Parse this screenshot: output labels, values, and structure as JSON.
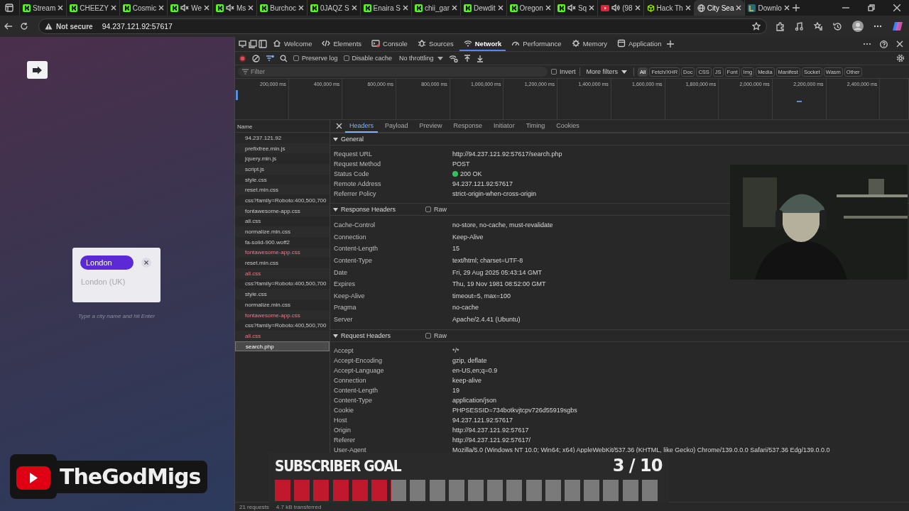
{
  "browser": {
    "tabs": [
      {
        "title": "Stream",
        "kind": "kick",
        "muted": false,
        "audible": false,
        "selected": false
      },
      {
        "title": "CHEEZY",
        "kind": "kick",
        "muted": false,
        "audible": false,
        "selected": false
      },
      {
        "title": "Cosmic",
        "kind": "kick",
        "muted": false,
        "audible": false,
        "selected": false
      },
      {
        "title": "We",
        "kind": "kick",
        "muted": true,
        "audible": false,
        "selected": false
      },
      {
        "title": "Ms",
        "kind": "kick",
        "muted": true,
        "audible": false,
        "selected": false
      },
      {
        "title": "Burchoc",
        "kind": "kick",
        "muted": false,
        "audible": false,
        "selected": false
      },
      {
        "title": "0JAQZ S",
        "kind": "kick",
        "muted": false,
        "audible": false,
        "selected": false
      },
      {
        "title": "Enaira S",
        "kind": "kick",
        "muted": false,
        "audible": false,
        "selected": false
      },
      {
        "title": "chii_gar",
        "kind": "kick",
        "muted": false,
        "audible": false,
        "selected": false
      },
      {
        "title": "Dewdit",
        "kind": "kick",
        "muted": false,
        "audible": false,
        "selected": false
      },
      {
        "title": "Oregon",
        "kind": "kick",
        "muted": false,
        "audible": false,
        "selected": false
      },
      {
        "title": "Sq",
        "kind": "kick",
        "muted": true,
        "audible": false,
        "selected": false
      },
      {
        "title": "(98",
        "kind": "video",
        "muted": false,
        "audible": true,
        "selected": false
      },
      {
        "title": "Hack Th",
        "kind": "cube",
        "muted": false,
        "audible": false,
        "selected": false
      },
      {
        "title": "City Sea",
        "kind": "globe",
        "muted": false,
        "audible": false,
        "selected": true
      },
      {
        "title": "Downlo",
        "kind": "download",
        "muted": false,
        "audible": false,
        "selected": false
      }
    ],
    "address": {
      "security": "Not secure",
      "url": "94.237.121.92:57617"
    }
  },
  "page": {
    "tags": [
      {
        "label": "London"
      }
    ],
    "suggestion": "London (UK)",
    "hint": "Type a city name and hit Enter"
  },
  "devtools": {
    "tabs": [
      {
        "label": "Welcome",
        "kind": "home",
        "selected": false
      },
      {
        "label": "Elements",
        "kind": "code",
        "selected": false
      },
      {
        "label": "Console",
        "kind": "console",
        "selected": false
      },
      {
        "label": "Sources",
        "kind": "bug",
        "selected": false
      },
      {
        "label": "Network",
        "kind": "wifi",
        "selected": true
      },
      {
        "label": "Performance",
        "kind": "gauge",
        "selected": false
      },
      {
        "label": "Memory",
        "kind": "chip",
        "selected": false
      },
      {
        "label": "Application",
        "kind": "window",
        "selected": false
      }
    ],
    "toolbar": {
      "preserve_log": {
        "label": "Preserve log",
        "checked": false
      },
      "disable_cache": {
        "label": "Disable cache",
        "checked": false
      },
      "throttling": "No throttling"
    },
    "filter": {
      "placeholder": "Filter",
      "invert": {
        "label": "Invert",
        "checked": false
      },
      "more_filters": "More filters",
      "types": [
        {
          "label": "All",
          "selected": true
        },
        {
          "label": "Fetch/XHR",
          "selected": false
        },
        {
          "label": "Doc",
          "selected": false
        },
        {
          "label": "CSS",
          "selected": false
        },
        {
          "label": "JS",
          "selected": false
        },
        {
          "label": "Font",
          "selected": false
        },
        {
          "label": "Img",
          "selected": false
        },
        {
          "label": "Media",
          "selected": false
        },
        {
          "label": "Manifest",
          "selected": false
        },
        {
          "label": "Socket",
          "selected": false
        },
        {
          "label": "Wasm",
          "selected": false
        },
        {
          "label": "Other",
          "selected": false
        }
      ]
    },
    "timeline": {
      "ticks": [
        "200,000 ms",
        "400,000 ms",
        "600,000 ms",
        "800,000 ms",
        "1,000,000 ms",
        "1,200,000 ms",
        "1,400,000 ms",
        "1,600,000 ms",
        "1,800,000 ms",
        "2,000,000 ms",
        "2,200,000 ms",
        "2,400,000 ms"
      ]
    },
    "requests": {
      "column": "Name",
      "items": [
        {
          "name": "94.237.121.92",
          "failed": false,
          "selected": false
        },
        {
          "name": "prefixfree.min.js",
          "failed": false,
          "selected": false
        },
        {
          "name": "jquery.min.js",
          "failed": false,
          "selected": false
        },
        {
          "name": "script.js",
          "failed": false,
          "selected": false
        },
        {
          "name": "style.css",
          "failed": false,
          "selected": false
        },
        {
          "name": "reset.min.css",
          "failed": false,
          "selected": false
        },
        {
          "name": "css?family=Roboto:400,500,700",
          "failed": false,
          "selected": false
        },
        {
          "name": "fontawesome-app.css",
          "failed": false,
          "selected": false
        },
        {
          "name": "all.css",
          "failed": false,
          "selected": false
        },
        {
          "name": "normalize.min.css",
          "failed": false,
          "selected": false
        },
        {
          "name": "fa-solid-900.woff2",
          "failed": false,
          "selected": false
        },
        {
          "name": "fontawesome-app.css",
          "failed": true,
          "selected": false
        },
        {
          "name": "reset.min.css",
          "failed": false,
          "selected": false
        },
        {
          "name": "all.css",
          "failed": true,
          "selected": false
        },
        {
          "name": "css?family=Roboto:400,500,700",
          "failed": false,
          "selected": false
        },
        {
          "name": "style.css",
          "failed": false,
          "selected": false
        },
        {
          "name": "normalize.min.css",
          "failed": false,
          "selected": false
        },
        {
          "name": "fontawesome-app.css",
          "failed": true,
          "selected": false
        },
        {
          "name": "css?family=Roboto:400,500,700",
          "failed": false,
          "selected": false
        },
        {
          "name": "all.css",
          "failed": true,
          "selected": false
        },
        {
          "name": "search.php",
          "failed": false,
          "selected": true
        }
      ]
    },
    "details": {
      "tabs": [
        {
          "label": "Headers",
          "selected": true
        },
        {
          "label": "Payload",
          "selected": false
        },
        {
          "label": "Preview",
          "selected": false
        },
        {
          "label": "Response",
          "selected": false
        },
        {
          "label": "Initiator",
          "selected": false
        },
        {
          "label": "Timing",
          "selected": false
        },
        {
          "label": "Cookies",
          "selected": false
        }
      ],
      "sections": [
        {
          "title": "General",
          "expanded": true,
          "rows": [
            {
              "kind": "plain",
              "name": "Request URL",
              "value": "http://94.237.121.92:57617/search.php"
            },
            {
              "kind": "plain",
              "name": "Request Method",
              "value": "POST"
            },
            {
              "kind": "status",
              "name": "Status Code",
              "value": "200 OK"
            },
            {
              "kind": "plain",
              "name": "Remote Address",
              "value": "94.237.121.92:57617"
            },
            {
              "kind": "plain",
              "name": "Referrer Policy",
              "value": "strict-origin-when-cross-origin"
            }
          ]
        },
        {
          "title": "Response Headers",
          "expanded": true,
          "raw": {
            "label": "Raw",
            "checked": false
          },
          "rows": [
            {
              "kind": "plain",
              "name": "Cache-Control",
              "value": "no-store, no-cache, must-revalidate"
            },
            {
              "kind": "plain",
              "name": "Connection",
              "value": "Keep-Alive"
            },
            {
              "kind": "plain",
              "name": "Content-Length",
              "value": "15"
            },
            {
              "kind": "plain",
              "name": "Content-Type",
              "value": "text/html; charset=UTF-8"
            },
            {
              "kind": "plain",
              "name": "Date",
              "value": "Fri, 29 Aug 2025 05:43:14 GMT"
            },
            {
              "kind": "plain",
              "name": "Expires",
              "value": "Thu, 19 Nov 1981 08:52:00 GMT"
            },
            {
              "kind": "plain",
              "name": "Keep-Alive",
              "value": "timeout=5, max=100"
            },
            {
              "kind": "plain",
              "name": "Pragma",
              "value": "no-cache"
            },
            {
              "kind": "plain",
              "name": "Server",
              "value": "Apache/2.4.41 (Ubuntu)"
            }
          ]
        },
        {
          "title": "Request Headers",
          "expanded": true,
          "raw": {
            "label": "Raw",
            "checked": false
          },
          "rows": [
            {
              "kind": "plain",
              "name": "Accept",
              "value": "*/*"
            },
            {
              "kind": "plain",
              "name": "Accept-Encoding",
              "value": "gzip, deflate"
            },
            {
              "kind": "plain",
              "name": "Accept-Language",
              "value": "en-US,en;q=0.9"
            },
            {
              "kind": "plain",
              "name": "Connection",
              "value": "keep-alive"
            },
            {
              "kind": "plain",
              "name": "Content-Length",
              "value": "19"
            },
            {
              "kind": "plain",
              "name": "Content-Type",
              "value": "application/json"
            },
            {
              "kind": "plain",
              "name": "Cookie",
              "value": "PHPSESSID=734botkvjtcpv726d55919sgbs"
            },
            {
              "kind": "plain",
              "name": "Host",
              "value": "94.237.121.92:57617"
            },
            {
              "kind": "plain",
              "name": "Origin",
              "value": "http://94.237.121.92:57617"
            },
            {
              "kind": "plain",
              "name": "Referer",
              "value": "http://94.237.121.92:57617/"
            },
            {
              "kind": "plain",
              "name": "User-Agent",
              "value": "Mozilla/5.0 (Windows NT 10.0; Win64; x64) AppleWebKit/537.36 (KHTML, like Gecko) Chrome/139.0.0.0 Safari/537.36 Edg/139.0.0.0"
            }
          ]
        }
      ]
    },
    "status_bar": {
      "requests": "21 requests",
      "transferred": "4.7 kB transferred"
    }
  },
  "overlay": {
    "channel": "TheGodMigs",
    "goal": {
      "title": "SUBSCRIBER GOAL",
      "count": "3 / 10",
      "level": 0.3
    }
  }
}
